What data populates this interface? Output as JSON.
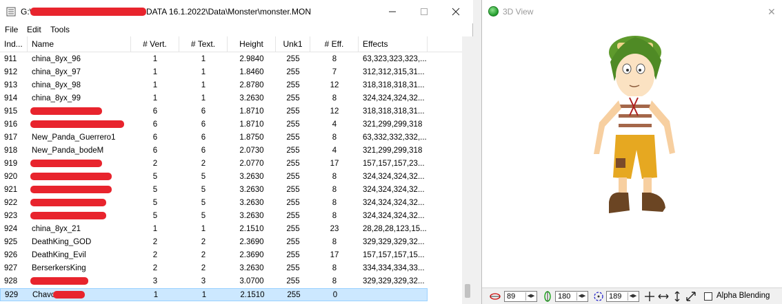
{
  "left_window": {
    "title_prefix": "G:\\",
    "title_suffix": "DATA 16.1.2022\\Data\\Monster\\monster.MON",
    "menu": [
      "File",
      "Edit",
      "Tools"
    ],
    "columns": [
      "Ind...",
      "Name",
      "# Vert.",
      "# Text.",
      "Height",
      "Unk1",
      "# Eff.",
      "Effects"
    ],
    "rows": [
      {
        "index": "911",
        "name": "china_8yx_96",
        "vert": "1",
        "text": "1",
        "height": "2.9840",
        "unk1": "255",
        "eff": "8",
        "effects": "63,323,323,323,...",
        "redacted": false
      },
      {
        "index": "912",
        "name": "china_8yx_97",
        "vert": "1",
        "text": "1",
        "height": "1.8460",
        "unk1": "255",
        "eff": "7",
        "effects": "312,312,315,31...",
        "redacted": false
      },
      {
        "index": "913",
        "name": "china_8yx_98",
        "vert": "1",
        "text": "1",
        "height": "2.8780",
        "unk1": "255",
        "eff": "12",
        "effects": "318,318,318,31...",
        "redacted": false
      },
      {
        "index": "914",
        "name": "china_8yx_99",
        "vert": "1",
        "text": "1",
        "height": "3.2630",
        "unk1": "255",
        "eff": "8",
        "effects": "324,324,324,32...",
        "redacted": false
      },
      {
        "index": "915",
        "name": "",
        "vert": "6",
        "text": "6",
        "height": "1.8710",
        "unk1": "255",
        "eff": "12",
        "effects": "318,318,318,31...",
        "redacted": true
      },
      {
        "index": "916",
        "name": "",
        "vert": "6",
        "text": "6",
        "height": "1.8710",
        "unk1": "255",
        "eff": "4",
        "effects": "321,299,299,318",
        "redacted": true
      },
      {
        "index": "917",
        "name": "New_Panda_Guerrero1",
        "vert": "6",
        "text": "6",
        "height": "1.8750",
        "unk1": "255",
        "eff": "8",
        "effects": "63,332,332,332,...",
        "redacted": false
      },
      {
        "index": "918",
        "name": "New_Panda_bodeM",
        "vert": "6",
        "text": "6",
        "height": "2.0730",
        "unk1": "255",
        "eff": "4",
        "effects": "321,299,299,318",
        "redacted": false
      },
      {
        "index": "919",
        "name": "",
        "vert": "2",
        "text": "2",
        "height": "2.0770",
        "unk1": "255",
        "eff": "17",
        "effects": "157,157,157,23...",
        "redacted": true
      },
      {
        "index": "920",
        "name": "",
        "vert": "5",
        "text": "5",
        "height": "3.2630",
        "unk1": "255",
        "eff": "8",
        "effects": "324,324,324,32...",
        "redacted": true
      },
      {
        "index": "921",
        "name": "",
        "vert": "5",
        "text": "5",
        "height": "3.2630",
        "unk1": "255",
        "eff": "8",
        "effects": "324,324,324,32...",
        "redacted": true
      },
      {
        "index": "922",
        "name": "",
        "vert": "5",
        "text": "5",
        "height": "3.2630",
        "unk1": "255",
        "eff": "8",
        "effects": "324,324,324,32...",
        "redacted": true
      },
      {
        "index": "923",
        "name": "",
        "vert": "5",
        "text": "5",
        "height": "3.2630",
        "unk1": "255",
        "eff": "8",
        "effects": "324,324,324,32...",
        "redacted": true
      },
      {
        "index": "924",
        "name": "china_8yx_21",
        "vert": "1",
        "text": "1",
        "height": "2.1510",
        "unk1": "255",
        "eff": "23",
        "effects": "28,28,28,123,15...",
        "redacted": false
      },
      {
        "index": "925",
        "name": "DeathKing_GOD",
        "vert": "2",
        "text": "2",
        "height": "2.3690",
        "unk1": "255",
        "eff": "8",
        "effects": "329,329,329,32...",
        "redacted": false
      },
      {
        "index": "926",
        "name": "DeathKing_Evil",
        "vert": "2",
        "text": "2",
        "height": "2.3690",
        "unk1": "255",
        "eff": "17",
        "effects": "157,157,157,15...",
        "redacted": false
      },
      {
        "index": "927",
        "name": "BerserkersKing",
        "vert": "2",
        "text": "2",
        "height": "3.2630",
        "unk1": "255",
        "eff": "8",
        "effects": "334,334,334,33...",
        "redacted": false
      },
      {
        "index": "928",
        "name": "",
        "vert": "3",
        "text": "3",
        "height": "3.0700",
        "unk1": "255",
        "eff": "8",
        "effects": "329,329,329,32...",
        "redacted": true
      },
      {
        "index": "929",
        "name": "Chavo",
        "vert": "1",
        "text": "1",
        "height": "2.1510",
        "unk1": "255",
        "eff": "0",
        "effects": "",
        "redacted": true,
        "selected": true
      }
    ]
  },
  "right_window": {
    "title": "3D View",
    "close": "✕",
    "controls": {
      "rot_x": "89",
      "rot_y": "180",
      "rot_z": "189",
      "alpha_label": "Alpha Blending",
      "alpha_checked": false
    }
  },
  "colors": {
    "redaction": "#e8242d",
    "selection": "#cce8ff"
  }
}
